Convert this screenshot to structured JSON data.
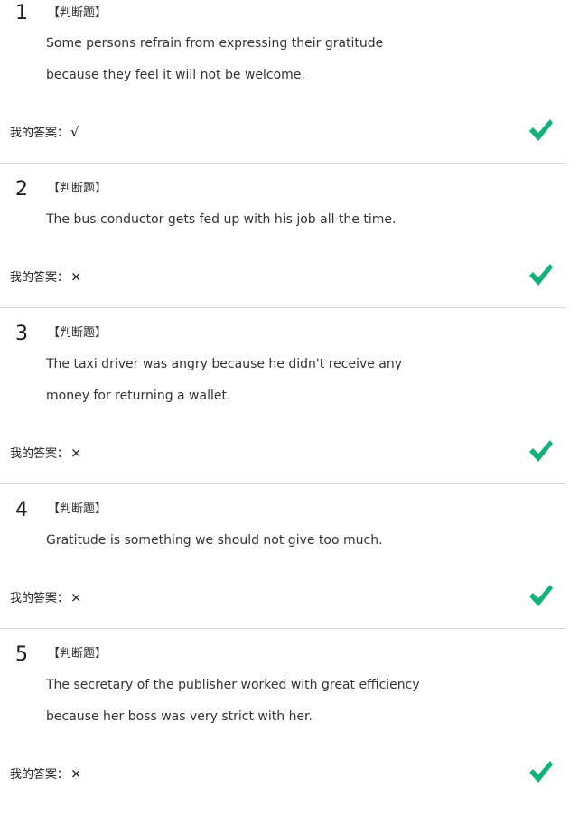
{
  "question_type_label": "【判断题】",
  "my_answer_label": "我的答案：",
  "colors": {
    "correct_check": "#12b27a",
    "divider": "#d6d6d6",
    "text": "#333333"
  },
  "questions": [
    {
      "number": "1",
      "lines": [
        "Some persons refrain from expressing their gratitude",
        "because they feel it will not be welcome."
      ],
      "answer": "√",
      "status_icon": "correct-check-icon"
    },
    {
      "number": "2",
      "lines": [
        "The bus conductor gets fed up with his job all the time."
      ],
      "answer": "×",
      "status_icon": "correct-check-icon"
    },
    {
      "number": "3",
      "lines": [
        "The taxi driver was angry because he didn't receive any",
        "money for returning a wallet."
      ],
      "answer": "×",
      "status_icon": "correct-check-icon"
    },
    {
      "number": "4",
      "lines": [
        "Gratitude is something we should not give too much."
      ],
      "answer": "×",
      "status_icon": "correct-check-icon"
    },
    {
      "number": "5",
      "lines": [
        "The secretary of the publisher worked with great efficiency",
        "because her boss was very strict with her."
      ],
      "answer": "×",
      "status_icon": "correct-check-icon"
    }
  ]
}
